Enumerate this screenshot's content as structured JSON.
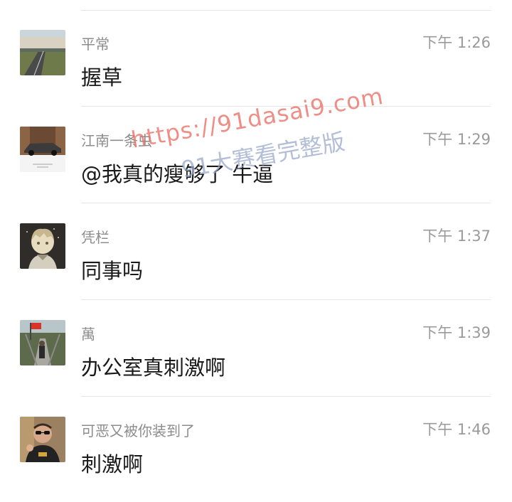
{
  "messages": [
    {
      "sender": "平常",
      "time": "下午 1:26",
      "content": "握草",
      "avatar_icon": "road-landscape-avatar"
    },
    {
      "sender": "江南一条虫",
      "time": "下午 1:29",
      "content": "@我真的瘦够了 牛逼",
      "avatar_icon": "car-photo-avatar"
    },
    {
      "sender": "凭栏",
      "time": "下午 1:37",
      "content": "同事吗",
      "avatar_icon": "anime-boy-avatar"
    },
    {
      "sender": "萬",
      "time": "下午 1:39",
      "content": "办公室真刺激啊",
      "avatar_icon": "bridge-flag-avatar"
    },
    {
      "sender": "可恶又被你装到了",
      "time": "下午 1:46",
      "content": "刺激啊",
      "avatar_icon": "man-with-glasses-avatar"
    }
  ],
  "watermark": {
    "url": "https://91dasai9.com",
    "text": "91大赛看完整版"
  }
}
